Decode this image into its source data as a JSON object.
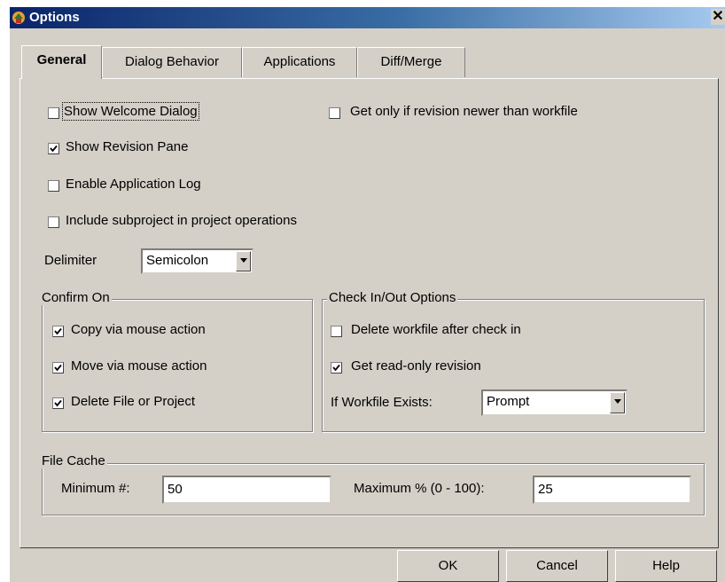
{
  "window": {
    "title": "Options"
  },
  "tabs": [
    {
      "label": "General",
      "active": true
    },
    {
      "label": "Dialog Behavior",
      "active": false
    },
    {
      "label": "Applications",
      "active": false
    },
    {
      "label": "Diff/Merge",
      "active": false
    }
  ],
  "general": {
    "show_welcome": {
      "label": "Show Welcome Dialog",
      "checked": false
    },
    "get_only_newer": {
      "label": "Get only if revision newer than workfile",
      "checked": false
    },
    "show_revision_pane": {
      "label": "Show Revision Pane",
      "checked": true
    },
    "enable_app_log": {
      "label": "Enable Application Log",
      "checked": false
    },
    "include_subproject": {
      "label": "Include subproject in project operations",
      "checked": false
    },
    "delimiter": {
      "label": "Delimiter",
      "value": "Semicolon"
    }
  },
  "confirm_on": {
    "title": "Confirm On",
    "copy": {
      "label": "Copy via mouse action",
      "checked": true
    },
    "move": {
      "label": "Move via mouse action",
      "checked": true
    },
    "delete": {
      "label": "Delete File or Project",
      "checked": true
    }
  },
  "checkinout": {
    "title": "Check In/Out Options",
    "delete_workfile": {
      "label": "Delete workfile after check in",
      "checked": false
    },
    "get_readonly": {
      "label": "Get read-only revision",
      "checked": true
    },
    "if_exists": {
      "label": "If Workfile Exists:",
      "value": "Prompt"
    }
  },
  "file_cache": {
    "title": "File Cache",
    "minimum": {
      "label": "Minimum #:",
      "value": "50"
    },
    "maximum": {
      "label": "Maximum % (0 - 100):",
      "value": "25"
    }
  },
  "buttons": {
    "ok": "OK",
    "cancel": "Cancel",
    "help": "Help"
  }
}
